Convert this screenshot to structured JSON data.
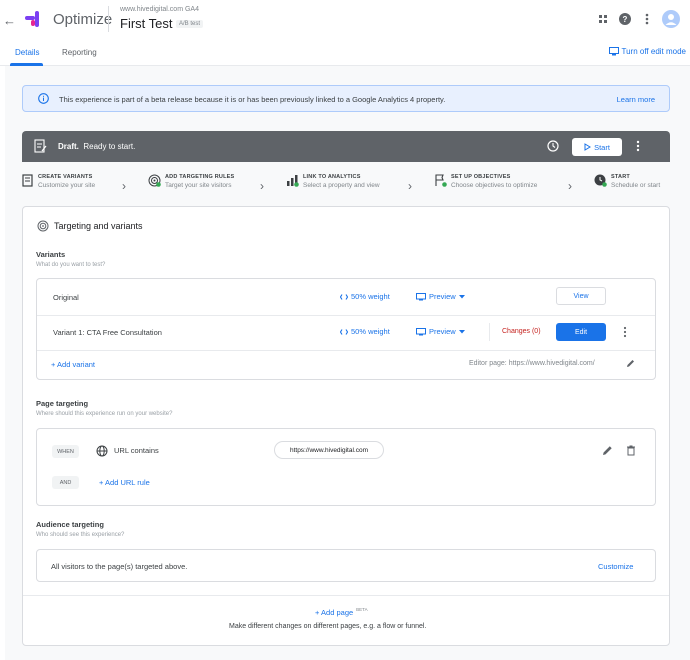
{
  "app": {
    "back_glyph": "←",
    "name": "Optimize",
    "account": "www.hivedigital.com GA4",
    "experience_name": "First Test",
    "experience_type": "A/B test",
    "icons": [
      "apps-grid-icon",
      "help-icon",
      "more-vert-icon",
      "account-avatar-icon"
    ]
  },
  "tabs": [
    {
      "label": "Details",
      "active": true
    },
    {
      "label": "Reporting",
      "active": false
    }
  ],
  "edit_mode_link": "Turn off edit mode",
  "beta_banner": {
    "text": "This experience is part of a beta release because it is or has been previously linked to a Google Analytics 4 property.",
    "link": "Learn more"
  },
  "status_bar": {
    "status": "Draft.",
    "detail": "Ready to start.",
    "start_label": "Start"
  },
  "steps": [
    {
      "title": "CREATE VARIANTS",
      "subtitle": "Customize your site"
    },
    {
      "title": "ADD TARGETING RULES",
      "subtitle": "Target your site visitors"
    },
    {
      "title": "LINK TO ANALYTICS",
      "subtitle": "Select a property and view"
    },
    {
      "title": "SET UP OBJECTIVES",
      "subtitle": "Choose objectives to optimize"
    },
    {
      "title": "START",
      "subtitle": "Schedule or start"
    }
  ],
  "targeting_section": {
    "title": "Targeting and variants"
  },
  "variants": {
    "label": "Variants",
    "sublabel": "What do you want to test?",
    "rows": [
      {
        "name": "Original",
        "weight": "50% weight",
        "preview": "Preview",
        "changes": "",
        "action": "View"
      },
      {
        "name": "Variant 1: CTA Free Consultation",
        "weight": "50% weight",
        "preview": "Preview",
        "changes": "Changes (0)",
        "action": "Edit"
      }
    ],
    "add_label": "+ Add variant",
    "editor_page": "Editor page: https://www.hivedigital.com/"
  },
  "page_targeting": {
    "label": "Page targeting",
    "sublabel": "Where should this experience run on your website?",
    "when_chip": "WHEN",
    "rule_type": "URL contains",
    "rule_value": "https://www.hivedigital.com",
    "and_chip": "AND",
    "add_rule": "+ Add URL rule"
  },
  "audience_targeting": {
    "label": "Audience targeting",
    "sublabel": "Who should see this experience?",
    "text": "All visitors to the page(s) targeted above.",
    "customize": "Customize"
  },
  "add_page": {
    "label": "+ Add page",
    "badge": "BETA",
    "description": "Make different changes on different pages, e.g. a flow or funnel."
  },
  "colors": {
    "accent": "#1a73e8",
    "status_bar": "#5f6368",
    "changes_red": "#c5221f",
    "logo_purple": "#7b3ff2",
    "logo_pink": "#e52592"
  }
}
